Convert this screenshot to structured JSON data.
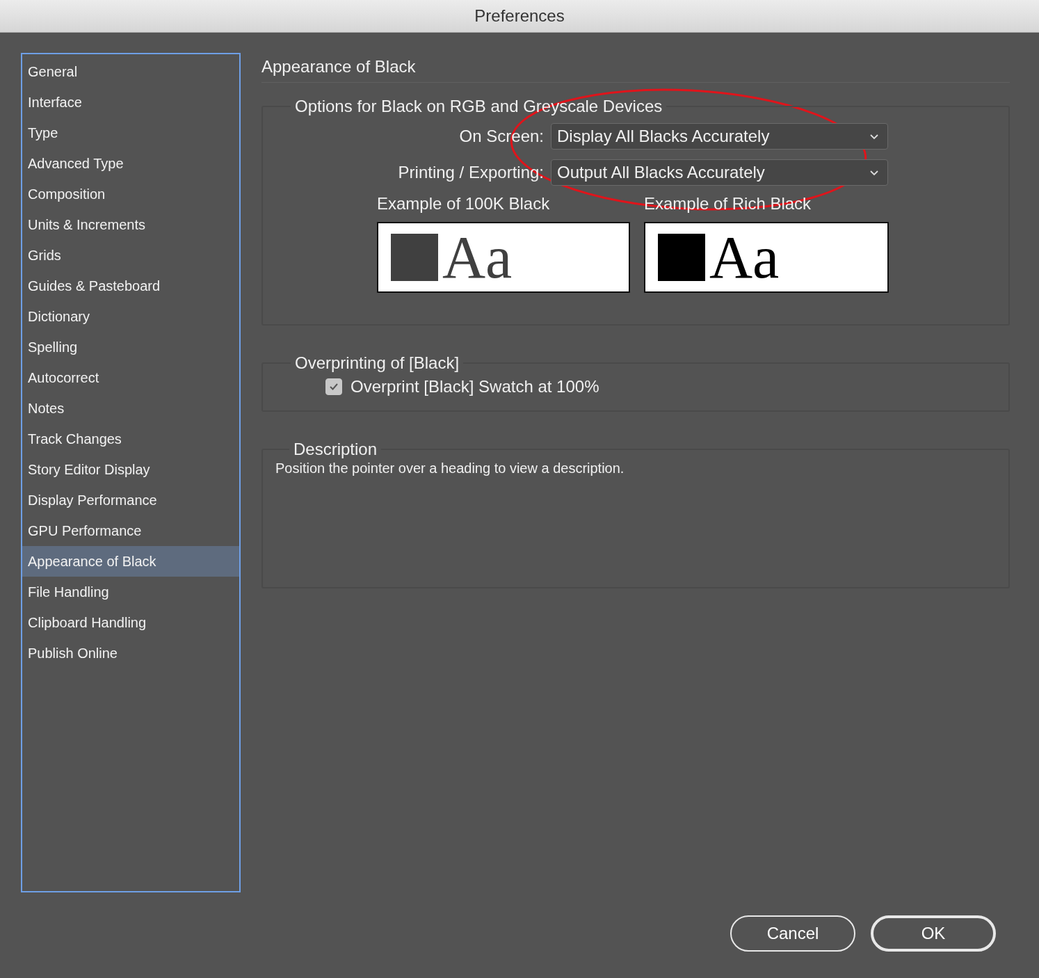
{
  "window": {
    "title": "Preferences"
  },
  "sidebar": {
    "items": [
      {
        "label": "General",
        "selected": false
      },
      {
        "label": "Interface",
        "selected": false
      },
      {
        "label": "Type",
        "selected": false
      },
      {
        "label": "Advanced Type",
        "selected": false
      },
      {
        "label": "Composition",
        "selected": false
      },
      {
        "label": "Units & Increments",
        "selected": false
      },
      {
        "label": "Grids",
        "selected": false
      },
      {
        "label": "Guides & Pasteboard",
        "selected": false
      },
      {
        "label": "Dictionary",
        "selected": false
      },
      {
        "label": "Spelling",
        "selected": false
      },
      {
        "label": "Autocorrect",
        "selected": false
      },
      {
        "label": "Notes",
        "selected": false
      },
      {
        "label": "Track Changes",
        "selected": false
      },
      {
        "label": "Story Editor Display",
        "selected": false
      },
      {
        "label": "Display Performance",
        "selected": false
      },
      {
        "label": "GPU Performance",
        "selected": false
      },
      {
        "label": "Appearance of Black",
        "selected": true
      },
      {
        "label": "File Handling",
        "selected": false
      },
      {
        "label": "Clipboard Handling",
        "selected": false
      },
      {
        "label": "Publish Online",
        "selected": false
      }
    ]
  },
  "panel": {
    "title": "Appearance of Black",
    "black_options": {
      "legend": "Options for Black on RGB and Greyscale Devices",
      "dropdowns": [
        {
          "label": "On Screen:",
          "value": "Display All Blacks Accurately"
        },
        {
          "label": "Printing / Exporting:",
          "value": "Output All Blacks Accurately"
        }
      ],
      "samples": [
        {
          "label": "Example of 100K Black",
          "text": "Aa",
          "color": "#404040"
        },
        {
          "label": "Example of Rich Black",
          "text": "Aa",
          "color": "#000000"
        }
      ]
    },
    "overprinting": {
      "legend": "Overprinting of [Black]",
      "checkbox": {
        "label": "Overprint [Black] Swatch at 100%",
        "checked": true
      }
    },
    "description": {
      "legend": "Description",
      "text": "Position the pointer over a heading to view a description."
    }
  },
  "buttons": [
    {
      "label": "Cancel",
      "default": false
    },
    {
      "label": "OK",
      "default": true
    }
  ]
}
